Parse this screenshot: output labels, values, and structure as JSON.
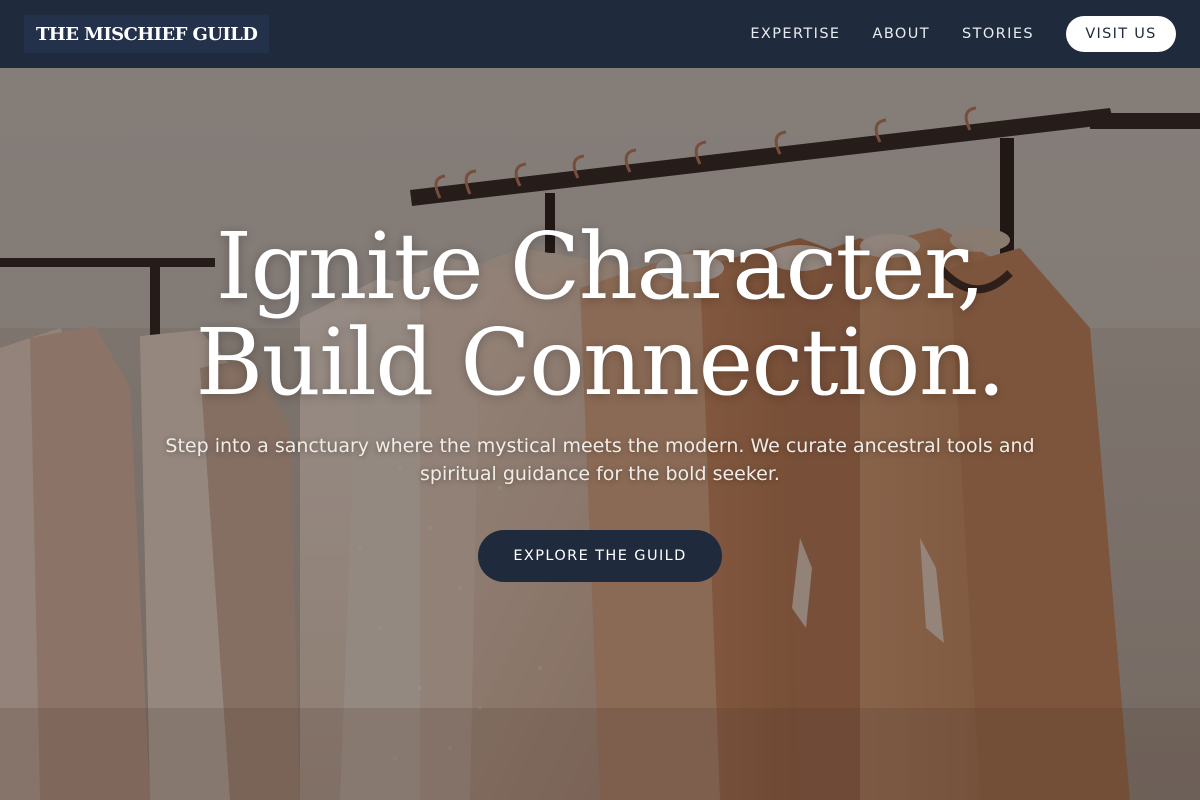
{
  "nav": {
    "brand": "THE MISCHIEF GUILD",
    "links": [
      "EXPERTISE",
      "ABOUT",
      "STORIES"
    ],
    "cta": "VISIT US"
  },
  "hero": {
    "headline_line1": "Ignite Character,",
    "headline_line2": "Build Connection.",
    "subtext": "Step into a sanctuary where the mystical meets the modern. We curate ancestral tools and spiritual guidance for the bold seeker.",
    "cta": "EXPLORE THE GUILD"
  },
  "colors": {
    "navy": "#1f2a3d",
    "white": "#ffffff"
  }
}
